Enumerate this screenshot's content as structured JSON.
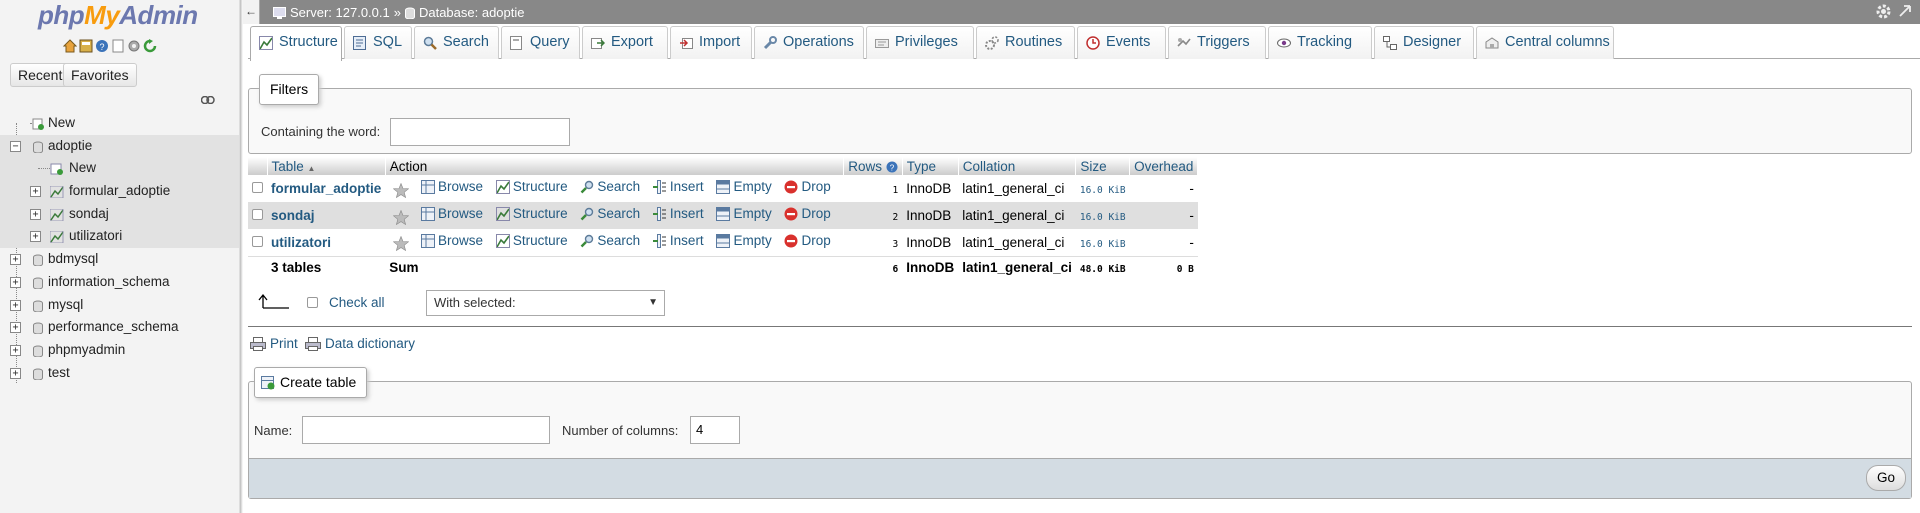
{
  "nav": {
    "logo_php": "php",
    "logo_my": "My",
    "logo_admin": "Admin",
    "icons": [
      "home-icon",
      "sql-window-icon",
      "help-icon",
      "docs-icon",
      "settings-icon",
      "reload-icon"
    ],
    "recent_label": "Recent",
    "favorites_label": "Favorites",
    "tree": {
      "new": "New",
      "adoptie": "adoptie",
      "adoptie_new": "New",
      "formular_adoptie": "formular_adoptie",
      "sondaj": "sondaj",
      "utilizatori": "utilizatori",
      "bdmysql": "bdmysql",
      "information_schema": "information_schema",
      "mysql": "mysql",
      "performance_schema": "performance_schema",
      "phpmyadmin": "phpmyadmin",
      "test": "test"
    }
  },
  "topbar": {
    "collapse": "←",
    "server": "Server: 127.0.0.1",
    "separator": "»",
    "database": "Database: adoptie"
  },
  "tabs": {
    "structure": "Structure",
    "sql": "SQL",
    "search": "Search",
    "query": "Query",
    "export": "Export",
    "import": "Import",
    "operations": "Operations",
    "privileges": "Privileges",
    "routines": "Routines",
    "events": "Events",
    "triggers": "Triggers",
    "tracking": "Tracking",
    "designer": "Designer",
    "central_columns": "Central columns"
  },
  "filters": {
    "legend": "Filters",
    "label": "Containing the word:",
    "value": ""
  },
  "table": {
    "headers": {
      "table": "Table",
      "sort_arrow": "▲",
      "action": "Action",
      "rows": "Rows",
      "type": "Type",
      "collation": "Collation",
      "size": "Size",
      "overhead": "Overhead"
    },
    "actions": {
      "browse": "Browse",
      "structure": "Structure",
      "search": "Search",
      "insert": "Insert",
      "empty": "Empty",
      "drop": "Drop"
    },
    "rows": [
      {
        "name": "formular_adoptie",
        "rows": "1",
        "type": "InnoDB",
        "collation": "latin1_general_ci",
        "size": "16.0 KiB",
        "overhead": "-"
      },
      {
        "name": "sondaj",
        "rows": "2",
        "type": "InnoDB",
        "collation": "latin1_general_ci",
        "size": "16.0 KiB",
        "overhead": "-"
      },
      {
        "name": "utilizatori",
        "rows": "3",
        "type": "InnoDB",
        "collation": "latin1_general_ci",
        "size": "16.0 KiB",
        "overhead": "-"
      }
    ],
    "footer": {
      "count": "3 tables",
      "sum": "Sum",
      "rows": "6",
      "type": "InnoDB",
      "collation": "latin1_general_ci",
      "size": "48.0 KiB",
      "overhead": "0 B"
    }
  },
  "bulk": {
    "check_all": "Check all",
    "with_selected": "With selected:",
    "caret": "▼"
  },
  "links": {
    "print": "Print",
    "data_dictionary": "Data dictionary"
  },
  "create": {
    "legend": "Create table",
    "name_label": "Name:",
    "name_value": "",
    "cols_label": "Number of columns:",
    "cols_value": "4",
    "go": "Go"
  },
  "colors": {
    "link": "#235a81",
    "topbar": "#888888",
    "logo_blue": "#6c78af",
    "logo_orange": "#f89c0e",
    "drop_red": "#d9312d"
  }
}
